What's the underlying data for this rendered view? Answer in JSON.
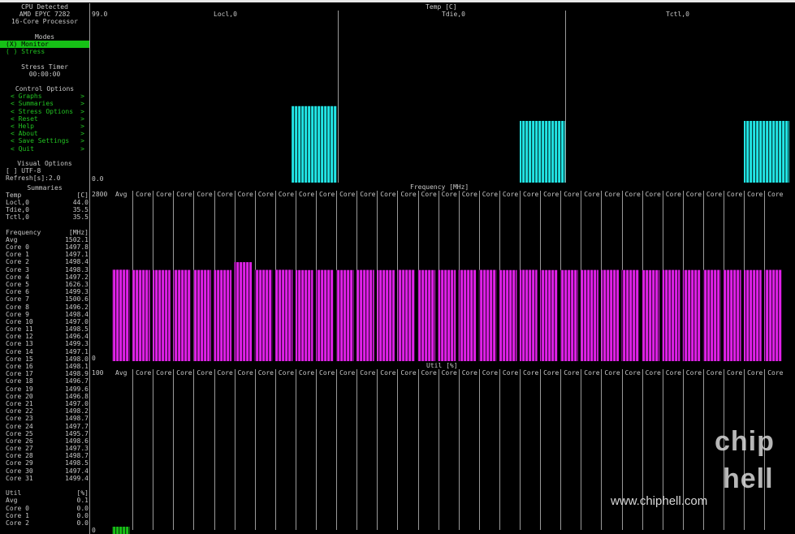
{
  "sidebar": {
    "cpu_title": "CPU Detected",
    "cpu_model": "AMD EPYC 7282",
    "cpu_desc": "16-Core Processor",
    "modes_title": "Modes",
    "modes": [
      {
        "label": "(X) Monitor",
        "selected": true
      },
      {
        "label": "( ) Stress",
        "selected": false
      }
    ],
    "stress_title": "Stress Timer",
    "stress_time": "00:00:00",
    "control_title": "Control Options",
    "controls": [
      {
        "left": "< Graphs",
        "right": ">"
      },
      {
        "left": "< Summaries",
        "right": ">"
      },
      {
        "left": "< Stress Options",
        "right": ">"
      },
      {
        "left": "< Reset",
        "right": ">"
      },
      {
        "left": "< Help",
        "right": ">"
      },
      {
        "left": "< About",
        "right": ">"
      },
      {
        "left": "< Save Settings",
        "right": ">"
      },
      {
        "left": "< Quit",
        "right": ">"
      }
    ],
    "visual_title": "Visual Options",
    "utf8_label": "[ ] UTF-8",
    "refresh_label": "Refresh[s]:2.0",
    "summaries_title": "Summaries",
    "temp_header": {
      "label": "Temp",
      "unit": "[C]"
    },
    "temp_rows": [
      {
        "label": "Locl,0",
        "value": "44.0"
      },
      {
        "label": "Tdie,0",
        "value": "35.5"
      },
      {
        "label": "Tctl,0",
        "value": "35.5"
      }
    ],
    "freq_header": {
      "label": "Frequency",
      "unit": "[MHz]"
    },
    "freq_rows": [
      {
        "label": "Avg",
        "value": "1502.1"
      },
      {
        "label": "Core 0",
        "value": "1497.8"
      },
      {
        "label": "Core 1",
        "value": "1497.1"
      },
      {
        "label": "Core 2",
        "value": "1498.4"
      },
      {
        "label": "Core 3",
        "value": "1498.3"
      },
      {
        "label": "Core 4",
        "value": "1497.2"
      },
      {
        "label": "Core 5",
        "value": "1626.3"
      },
      {
        "label": "Core 6",
        "value": "1499.3"
      },
      {
        "label": "Core 7",
        "value": "1500.6"
      },
      {
        "label": "Core 8",
        "value": "1496.2"
      },
      {
        "label": "Core 9",
        "value": "1498.4"
      },
      {
        "label": "Core 10",
        "value": "1497.0"
      },
      {
        "label": "Core 11",
        "value": "1498.5"
      },
      {
        "label": "Core 12",
        "value": "1496.4"
      },
      {
        "label": "Core 13",
        "value": "1499.3"
      },
      {
        "label": "Core 14",
        "value": "1497.1"
      },
      {
        "label": "Core 15",
        "value": "1498.0"
      },
      {
        "label": "Core 16",
        "value": "1498.1"
      },
      {
        "label": "Core 17",
        "value": "1498.9"
      },
      {
        "label": "Core 18",
        "value": "1496.7"
      },
      {
        "label": "Core 19",
        "value": "1499.6"
      },
      {
        "label": "Core 20",
        "value": "1496.8"
      },
      {
        "label": "Core 21",
        "value": "1497.0"
      },
      {
        "label": "Core 22",
        "value": "1498.2"
      },
      {
        "label": "Core 23",
        "value": "1498.7"
      },
      {
        "label": "Core 24",
        "value": "1497.7"
      },
      {
        "label": "Core 25",
        "value": "1495.7"
      },
      {
        "label": "Core 26",
        "value": "1498.6"
      },
      {
        "label": "Core 27",
        "value": "1497.3"
      },
      {
        "label": "Core 28",
        "value": "1498.7"
      },
      {
        "label": "Core 29",
        "value": "1498.5"
      },
      {
        "label": "Core 30",
        "value": "1497.4"
      },
      {
        "label": "Core 31",
        "value": "1499.4"
      }
    ],
    "util_header": {
      "label": "Util",
      "unit": "[%]"
    },
    "util_rows": [
      {
        "label": "Avg",
        "value": "0.1"
      },
      {
        "label": "Core 0",
        "value": "0.0"
      },
      {
        "label": "Core 1",
        "value": "0.0"
      },
      {
        "label": "Core 2",
        "value": "0.0"
      }
    ]
  },
  "colors": {
    "accent_green": "#16c016",
    "temp_bar": "#22e6e6",
    "freq_bar": "#e020e8",
    "util_bar": "#16c016"
  },
  "temp_panel": {
    "title": "Temp [C]",
    "ymax_label": "99.0",
    "ymin_label": "0.0",
    "series_labels": [
      "Locl,0",
      "Tdie,0",
      "Tctl,0"
    ]
  },
  "freq_panel": {
    "title": "Frequency [MHz]",
    "ymax_label": "2800",
    "ymin_label": "0",
    "col_label": "Core",
    "avg_label": "Avg"
  },
  "util_panel": {
    "title": "Util [%]",
    "ymax_label": "100",
    "ymin_label": "0",
    "col_label": "Core",
    "avg_label": "Avg"
  },
  "watermark": {
    "site": "www.chiphell.com",
    "logo_top": "chip",
    "logo_bottom": "hell"
  },
  "chart_data": [
    {
      "type": "bar",
      "title": "Temp [C]",
      "categories": [
        "Locl,0",
        "Tdie,0",
        "Tctl,0"
      ],
      "values": [
        44.0,
        35.5,
        35.5
      ],
      "ylim": [
        0,
        99.0
      ]
    },
    {
      "type": "bar",
      "title": "Frequency [MHz]",
      "categories": [
        "Avg",
        "Core",
        "Core",
        "Core",
        "Core",
        "Core",
        "Core",
        "Core",
        "Core",
        "Core",
        "Core",
        "Core",
        "Core",
        "Core",
        "Core",
        "Core",
        "Core",
        "Core",
        "Core",
        "Core",
        "Core",
        "Core",
        "Core",
        "Core",
        "Core",
        "Core",
        "Core",
        "Core",
        "Core",
        "Core",
        "Core",
        "Core",
        "Core"
      ],
      "values": [
        1502.1,
        1497.8,
        1497.1,
        1498.4,
        1498.3,
        1497.2,
        1626.3,
        1499.3,
        1500.6,
        1496.2,
        1498.4,
        1497.0,
        1498.5,
        1496.4,
        1499.3,
        1497.1,
        1498.0,
        1498.1,
        1498.9,
        1496.7,
        1499.6,
        1496.8,
        1497.0,
        1498.2,
        1498.7,
        1497.7,
        1495.7,
        1498.6,
        1497.3,
        1498.7,
        1498.5,
        1497.4,
        1499.4
      ],
      "ylim": [
        0,
        2800
      ]
    },
    {
      "type": "bar",
      "title": "Util [%]",
      "categories": [
        "Avg",
        "Core",
        "Core",
        "Core",
        "Core"
      ],
      "values": [
        0.1,
        0.0,
        0.0,
        0.0
      ],
      "ylim": [
        0,
        100
      ]
    }
  ]
}
